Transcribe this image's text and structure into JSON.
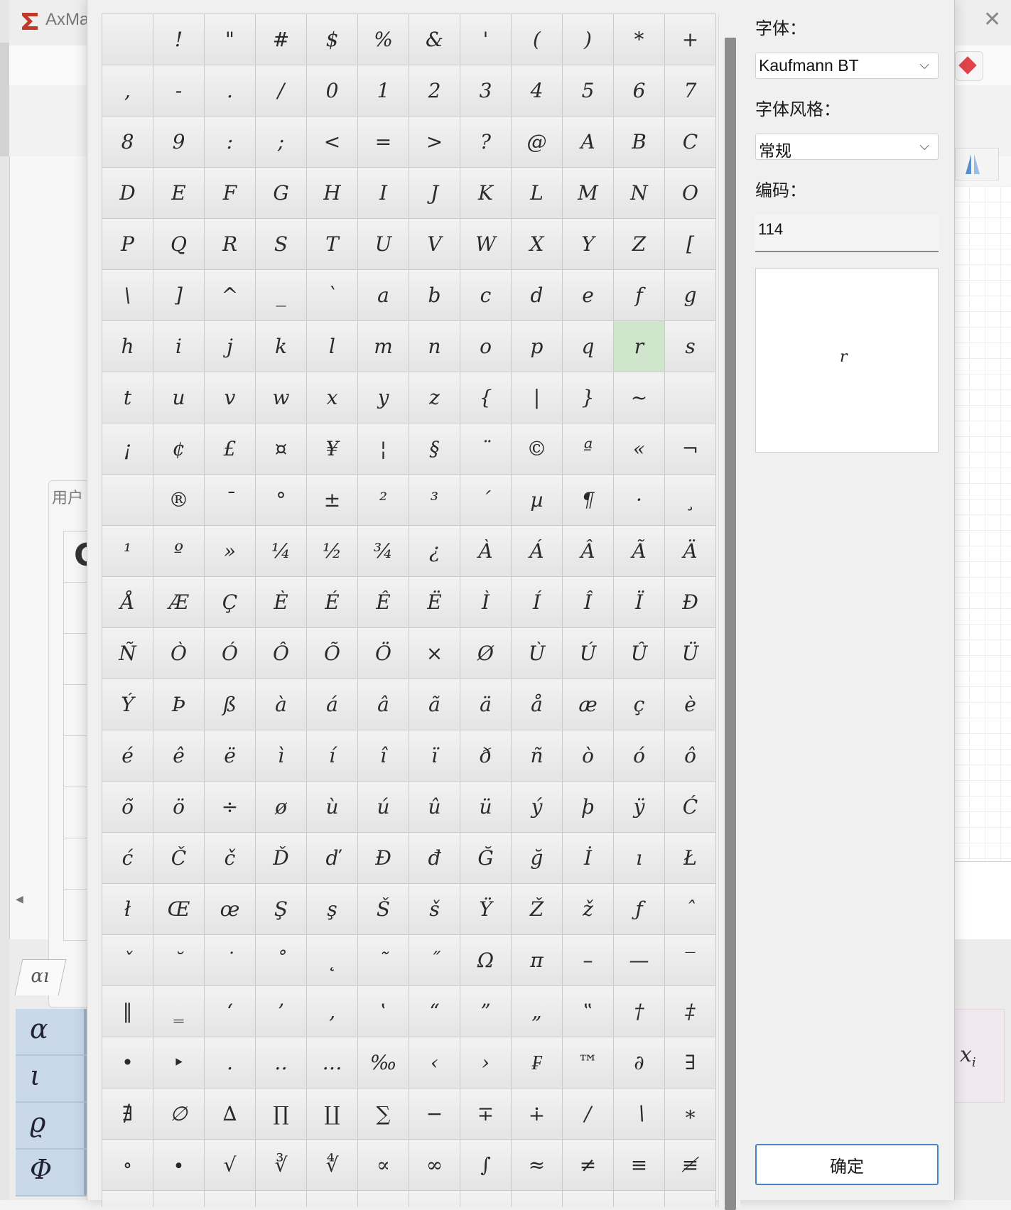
{
  "app": {
    "title": "AxMa"
  },
  "user_panel": {
    "label": "用户",
    "glyph": "C"
  },
  "bg_lower": {
    "tab_glyph": "αı",
    "greek": [
      "α",
      "ι",
      "ϱ",
      "Φ"
    ],
    "xi_label": "x",
    "xi_sub": "i"
  },
  "icons": {
    "logo": "sigma-logo-icon",
    "close": "close-icon",
    "chevron": "chevron-down-icon",
    "scroll_left": "scroll-left-icon",
    "prism": "prism-icon",
    "red_diamond": "red-diamond-icon"
  },
  "dialog": {
    "font_label": "字体：",
    "font_value": "Kaufmann BT",
    "style_label": "字体风格：",
    "style_value": "常规",
    "code_label": "编码：",
    "code_value": "114",
    "preview_char": "r",
    "ok_label": "确定",
    "selected_char": "r",
    "selected_color": "#cfe5cc",
    "rows": [
      [
        " ",
        "!",
        "\"",
        "#",
        "$",
        "%",
        "&",
        "'",
        "(",
        ")",
        "*",
        "+"
      ],
      [
        ",",
        "-",
        ".",
        "/",
        "0",
        "1",
        "2",
        "3",
        "4",
        "5",
        "6",
        "7"
      ],
      [
        "8",
        "9",
        ":",
        ";",
        "<",
        "=",
        ">",
        "?",
        "@",
        "A",
        "B",
        "C"
      ],
      [
        "D",
        "E",
        "F",
        "G",
        "H",
        "I",
        "J",
        "K",
        "L",
        "M",
        "N",
        "O"
      ],
      [
        "P",
        "Q",
        "R",
        "S",
        "T",
        "U",
        "V",
        "W",
        "X",
        "Y",
        "Z",
        "["
      ],
      [
        "\\",
        "]",
        "^",
        "_",
        "`",
        "a",
        "b",
        "c",
        "d",
        "e",
        "f",
        "g"
      ],
      [
        "h",
        "i",
        "j",
        "k",
        "l",
        "m",
        "n",
        "o",
        "p",
        "q",
        "r",
        "s"
      ],
      [
        "t",
        "u",
        "v",
        "w",
        "x",
        "y",
        "z",
        "{",
        "|",
        "}",
        "~",
        ""
      ],
      [
        "¡",
        "¢",
        "£",
        "¤",
        "¥",
        "¦",
        "§",
        "¨",
        "©",
        "ª",
        "«",
        "¬"
      ],
      [
        "",
        "®",
        "¯",
        "°",
        "±",
        "²",
        "³",
        "´",
        "µ",
        "¶",
        "·",
        "¸"
      ],
      [
        "¹",
        "º",
        "»",
        "¼",
        "½",
        "¾",
        "¿",
        "À",
        "Á",
        "Â",
        "Ã",
        "Ä"
      ],
      [
        "Å",
        "Æ",
        "Ç",
        "È",
        "É",
        "Ê",
        "Ë",
        "Ì",
        "Í",
        "Î",
        "Ï",
        "Ð"
      ],
      [
        "Ñ",
        "Ò",
        "Ó",
        "Ô",
        "Õ",
        "Ö",
        "×",
        "Ø",
        "Ù",
        "Ú",
        "Û",
        "Ü"
      ],
      [
        "Ý",
        "Þ",
        "ß",
        "à",
        "á",
        "â",
        "ã",
        "ä",
        "å",
        "æ",
        "ç",
        "è"
      ],
      [
        "é",
        "ê",
        "ë",
        "ì",
        "í",
        "î",
        "ï",
        "ð",
        "ñ",
        "ò",
        "ó",
        "ô"
      ],
      [
        "õ",
        "ö",
        "÷",
        "ø",
        "ù",
        "ú",
        "û",
        "ü",
        "ý",
        "þ",
        "ÿ",
        "Ć"
      ],
      [
        "ć",
        "Č",
        "č",
        "Ď",
        "ď",
        "Đ",
        "đ",
        "Ğ",
        "ğ",
        "İ",
        "ı",
        "Ł"
      ],
      [
        "ł",
        "Œ",
        "œ",
        "Ş",
        "ş",
        "Š",
        "š",
        "Ÿ",
        "Ž",
        "ž",
        "ƒ",
        "ˆ"
      ],
      [
        "ˇ",
        "˘",
        "˙",
        "˚",
        "˛",
        "˜",
        "˝",
        "Ω",
        "π",
        "–",
        "—",
        "‾"
      ],
      [
        "‖",
        "‗",
        "‘",
        "’",
        "‚",
        "‛",
        "“",
        "”",
        "„",
        "‟",
        "†",
        "‡"
      ],
      [
        "•",
        "‣",
        "․",
        "‥",
        "…",
        "‰",
        "‹",
        "›",
        "₣",
        "™",
        "∂",
        "∃"
      ],
      [
        "∄",
        "∅",
        "∆",
        "∏",
        "∐",
        "∑",
        "−",
        "∓",
        "∔",
        "∕",
        "∖",
        "∗"
      ],
      [
        "∘",
        "∙",
        "√",
        "∛",
        "∜",
        "∝",
        "∞",
        "∫",
        "≈",
        "≠",
        "≡",
        "≢"
      ],
      [
        "",
        "",
        "",
        "",
        "",
        "",
        "",
        "",
        "",
        "",
        "",
        ""
      ]
    ]
  }
}
